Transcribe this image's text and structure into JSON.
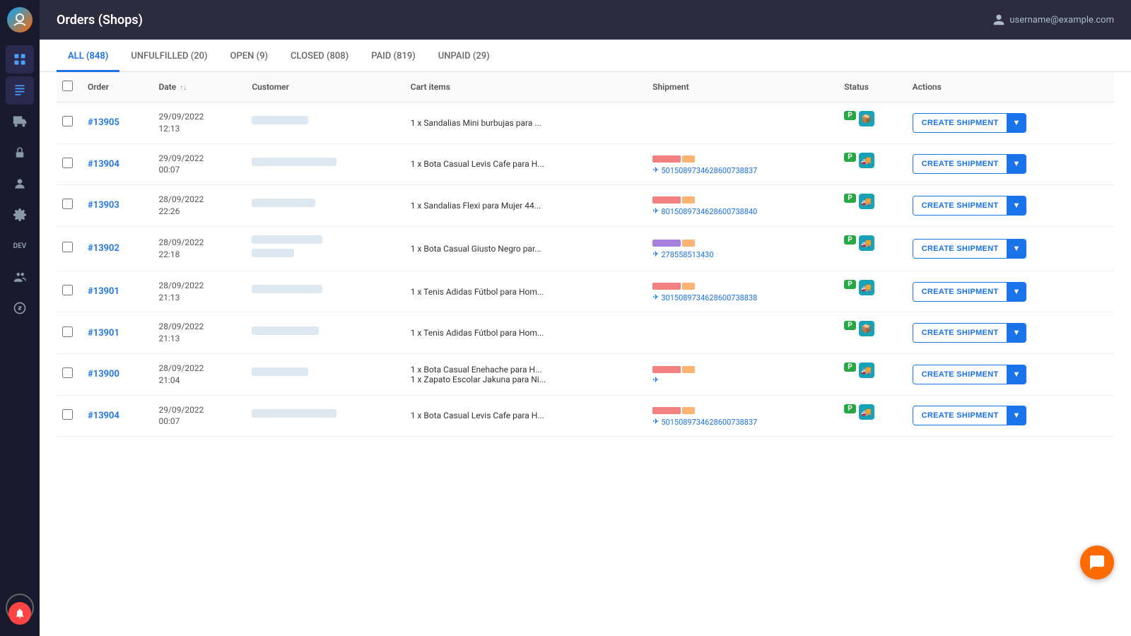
{
  "app": {
    "title": "Orders (Shops)"
  },
  "topbar": {
    "title": "Orders (Shops)",
    "user": "username@example.com"
  },
  "tabs": [
    {
      "id": "all",
      "label": "ALL (848)",
      "active": true
    },
    {
      "id": "unfulfilled",
      "label": "UNFULFILLED (20)",
      "active": false
    },
    {
      "id": "open",
      "label": "OPEN (9)",
      "active": false
    },
    {
      "id": "closed",
      "label": "CLOSED (808)",
      "active": false
    },
    {
      "id": "paid",
      "label": "PAID (819)",
      "active": false
    },
    {
      "id": "unpaid",
      "label": "UNPAID (29)",
      "active": false
    }
  ],
  "table": {
    "headers": [
      "",
      "Order",
      "Date",
      "Customer",
      "Cart items",
      "Shipment",
      "Status",
      "Actions"
    ],
    "date_sort_label": "Date",
    "btn_create": "CREATE SHIPMENT"
  },
  "orders": [
    {
      "id": "#13905",
      "date": "29/09/2022",
      "time": "12:13",
      "customer_blur_widths": [
        80
      ],
      "cart_items": "1 x Sandalias Mini burbujas para ...",
      "tracking": "",
      "has_red_bar": false,
      "has_tracking": false
    },
    {
      "id": "#13904",
      "date": "29/09/2022",
      "time": "00:07",
      "customer_blur_widths": [
        120
      ],
      "cart_items": "1 x Bota Casual Levis Cafe para H...",
      "tracking": "501508973462860​0738837",
      "has_red_bar": true,
      "has_tracking": true
    },
    {
      "id": "#13903",
      "date": "28/09/2022",
      "time": "22:26",
      "customer_blur_widths": [
        90
      ],
      "cart_items": "1 x Sandalias Flexi para Mujer 44...",
      "tracking": "801508973462860​0738840",
      "has_red_bar": true,
      "has_tracking": true
    },
    {
      "id": "#13902",
      "date": "28/09/2022",
      "time": "22:18",
      "customer_blur_widths": [
        100,
        60
      ],
      "cart_items": "1 x Bota Casual Giusto Negro par...",
      "tracking": "278558513430",
      "has_red_bar": true,
      "has_tracking": true,
      "tracking_purple": true
    },
    {
      "id": "#13901",
      "date": "28/09/2022",
      "time": "21:13",
      "customer_blur_widths": [
        100
      ],
      "cart_items": "1 x Tenis Adidas Fútbol para Hom...",
      "tracking": "301508973462860​0738838",
      "has_red_bar": true,
      "has_tracking": true
    },
    {
      "id": "#13901",
      "date": "28/09/2022",
      "time": "21:13",
      "customer_blur_widths": [
        95
      ],
      "cart_items": "1 x Tenis Adidas Fútbol para Hom...",
      "tracking": "",
      "has_red_bar": false,
      "has_tracking": false
    },
    {
      "id": "#13900",
      "date": "28/09/2022",
      "time": "21:04",
      "customer_blur_widths": [
        80
      ],
      "cart_items": "1 x Bota Casual Enehache para H...\n1 x Zapato Escolar Jakuna para Ni...",
      "tracking": "",
      "has_red_bar": true,
      "has_tracking": true
    },
    {
      "id": "#13904",
      "date": "29/09/2022",
      "time": "00:07",
      "customer_blur_widths": [
        120
      ],
      "cart_items": "1 x Bota Casual Levis Cafe para H...",
      "tracking": "501508973462860​0738837",
      "has_red_bar": true,
      "has_tracking": true
    }
  ],
  "sidebar": {
    "icons": [
      {
        "name": "dashboard-icon",
        "symbol": "⊞",
        "active": false
      },
      {
        "name": "orders-icon",
        "symbol": "📋",
        "active": true
      },
      {
        "name": "shipping-icon",
        "symbol": "🚚",
        "active": false
      },
      {
        "name": "lock-icon",
        "symbol": "🔒",
        "active": false
      },
      {
        "name": "users-icon",
        "symbol": "👤",
        "active": false
      },
      {
        "name": "settings-icon",
        "symbol": "⚙",
        "active": false
      },
      {
        "name": "dev-icon",
        "symbol": "DEV",
        "active": false
      },
      {
        "name": "team-icon",
        "symbol": "👥",
        "active": false
      },
      {
        "name": "billing-icon",
        "symbol": "💰",
        "active": false
      },
      {
        "name": "help-icon",
        "symbol": "?",
        "active": false
      }
    ]
  }
}
